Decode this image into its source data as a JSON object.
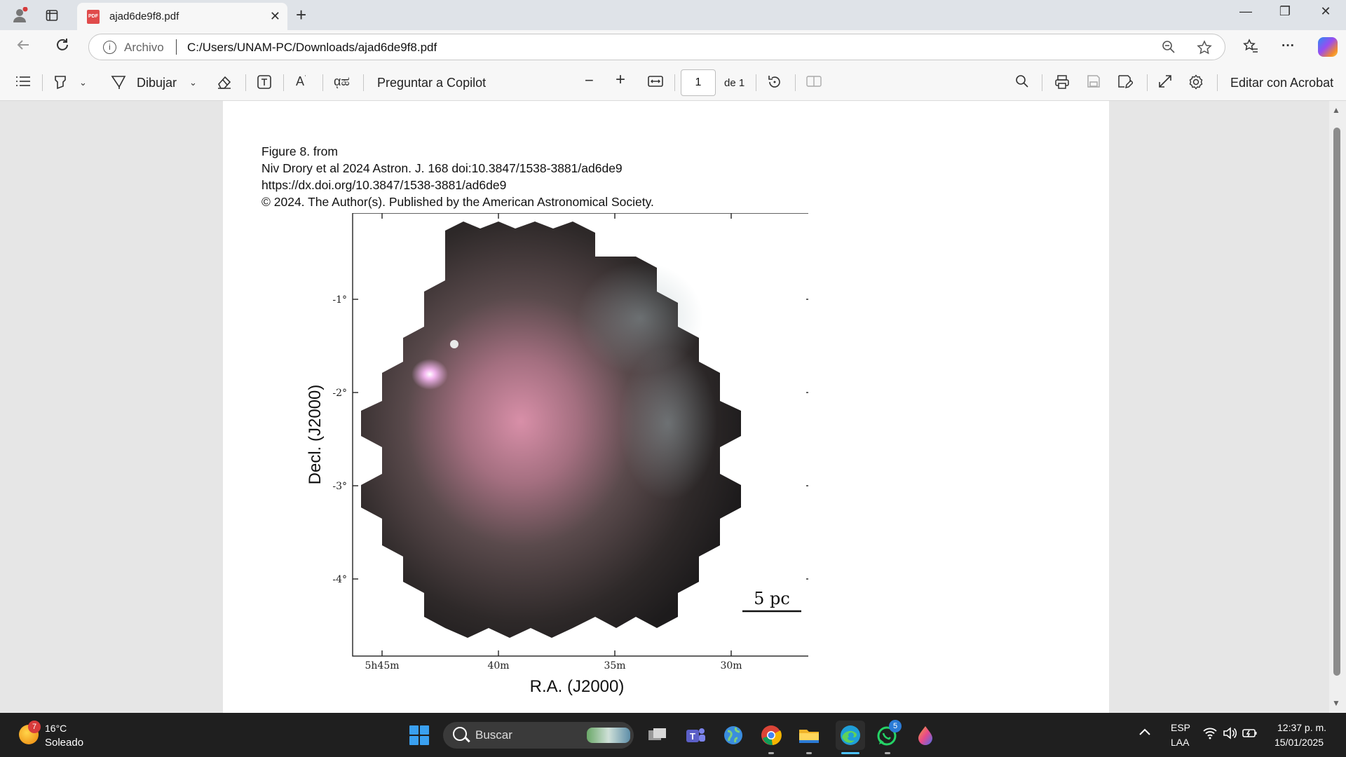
{
  "browser": {
    "tab_title": "ajad6de9f8.pdf",
    "tab_close": "✕",
    "new_tab": "+",
    "pdf_icon_text": "PDF",
    "window_controls": {
      "minimize": "—",
      "restore": "❐",
      "close": "✕"
    }
  },
  "address_bar": {
    "scheme_label": "Archivo",
    "url": "C:/Users/UNAM-PC/Downloads/ajad6de9f8.pdf"
  },
  "pdf_toolbar": {
    "draw_label": "Dibujar",
    "copilot_label": "Preguntar a Copilot",
    "page_current": "1",
    "page_total": "de 1",
    "edit_acrobat_label": "Editar con Acrobat"
  },
  "document": {
    "caption_lines": [
      "Figure 8. from",
      "Niv Drory et al 2024 Astron. J. 168 doi:10.3847/1538-3881/ad6de9",
      "https://dx.doi.org/10.3847/1538-3881/ad6de9",
      "© 2024. The Author(s). Published by the American Astronomical Society."
    ],
    "figure": {
      "y_axis_label": "Decl. (J2000)",
      "x_axis_label": "R.A. (J2000)",
      "y_ticks": [
        "-1°",
        "-2°",
        "-3°",
        "-4°"
      ],
      "x_ticks": [
        "5h45m",
        "40m",
        "35m",
        "30m"
      ],
      "scale_bar_label": "5 pc"
    }
  },
  "taskbar": {
    "weather_temp": "16°C",
    "weather_condition": "Soleado",
    "weather_badge": "7",
    "search_placeholder": "Buscar",
    "whatsapp_badge": "5",
    "language_line1": "ESP",
    "language_line2": "LAA",
    "time": "12:37 p. m.",
    "date": "15/01/2025"
  }
}
